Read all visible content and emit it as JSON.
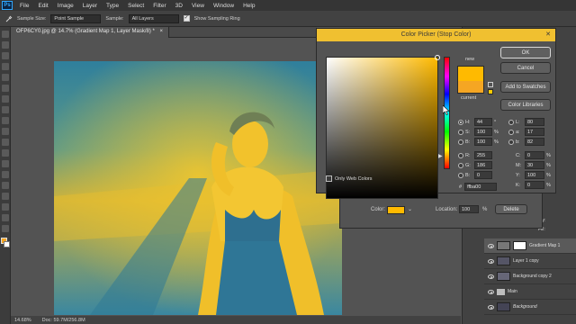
{
  "app": {
    "logo": "Ps"
  },
  "menu": [
    "File",
    "Edit",
    "Image",
    "Layer",
    "Type",
    "Select",
    "Filter",
    "3D",
    "View",
    "Window",
    "Help"
  ],
  "options": {
    "sample_size_label": "Sample Size:",
    "sample_size_value": "Point Sample",
    "sample_label": "Sample:",
    "sample_value": "All Layers",
    "show_ring_label": "Show Sampling Ring",
    "show_ring_checked": true
  },
  "document": {
    "tab_title": "OFP6CY0.jpg @ 14.7% (Gradient Map 1, Layer Mask/8) *",
    "close_glyph": "×"
  },
  "status": {
    "zoom": "14.68%",
    "doc_size": "Doc: 59.7M/256.8M"
  },
  "color_picker": {
    "title": "Color Picker (Stop Color)",
    "new_label": "new",
    "current_label": "current",
    "new_color": "#ffba00",
    "current_color": "#f5a623",
    "buttons": {
      "ok": "OK",
      "cancel": "Cancel",
      "add_swatches": "Add to Swatches",
      "libraries": "Color Libraries"
    },
    "only_web_colors": "Only Web Colors",
    "hex_prefix": "#",
    "hex": "ffba00",
    "hsb": [
      {
        "label": "H:",
        "value": "44",
        "unit": "°",
        "selected": true
      },
      {
        "label": "S:",
        "value": "100",
        "unit": "%",
        "selected": false
      },
      {
        "label": "B:",
        "value": "100",
        "unit": "%",
        "selected": false
      }
    ],
    "rgb": [
      {
        "label": "R:",
        "value": "255"
      },
      {
        "label": "G:",
        "value": "186"
      },
      {
        "label": "B:",
        "value": "0"
      }
    ],
    "lab": [
      {
        "label": "L:",
        "value": "80"
      },
      {
        "label": "a:",
        "value": "17"
      },
      {
        "label": "b:",
        "value": "82"
      }
    ],
    "cmyk": [
      {
        "label": "C:",
        "value": "0",
        "unit": "%"
      },
      {
        "label": "M:",
        "value": "30",
        "unit": "%"
      },
      {
        "label": "Y:",
        "value": "100",
        "unit": "%"
      },
      {
        "label": "K:",
        "value": "0",
        "unit": "%"
      }
    ]
  },
  "gradient_editor": {
    "color_label": "Color:",
    "color_swatch": "#ffba00",
    "location_label": "Location:",
    "location_value": "100",
    "location_unit": "%",
    "delete_label": "Delete"
  },
  "layers": {
    "opacity_label": "Opacity:",
    "fill_label": "Fill:",
    "items": [
      {
        "name": "Gradient Map 1",
        "selected": true
      },
      {
        "name": "Layer 1 copy",
        "selected": false
      },
      {
        "name": "Background copy 2",
        "selected": false
      },
      {
        "name": "Main",
        "selected": false
      },
      {
        "name": "Background",
        "selected": false
      }
    ]
  }
}
